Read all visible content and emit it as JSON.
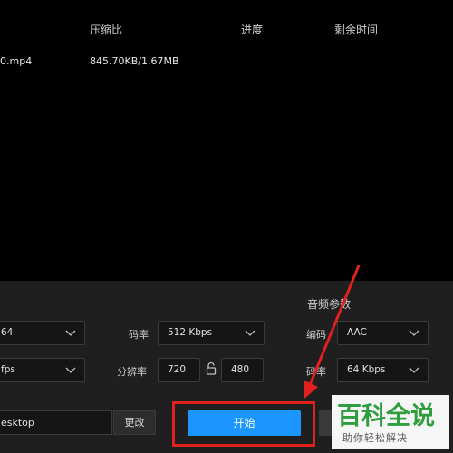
{
  "columns": {
    "ratio": "压缩比",
    "progress": "进度",
    "remaining": "剩余时间"
  },
  "file_row": {
    "name": "0.mp4",
    "ratio": "845.70KB/1.67MB"
  },
  "settings": {
    "audio_section_title": "音频参数",
    "video_codec": "64",
    "bitrate_label": "码率",
    "bitrate_value": "512 Kbps",
    "audio_codec_label": "编码",
    "audio_codec_value": "AAC",
    "fps_value": "fps",
    "resolution_label": "分辨率",
    "width": "720",
    "height": "480",
    "audio_bitrate_label": "码率",
    "audio_bitrate_value": "64 Kbps"
  },
  "output": {
    "path": "esktop",
    "change_label": "更改"
  },
  "actions": {
    "start_label": "开始"
  },
  "watermark": {
    "subtitle": "助你轻松解决"
  },
  "colors": {
    "accent": "#1b96ff",
    "highlight": "#e0211f",
    "watermark_green": "#2e9e3e"
  }
}
